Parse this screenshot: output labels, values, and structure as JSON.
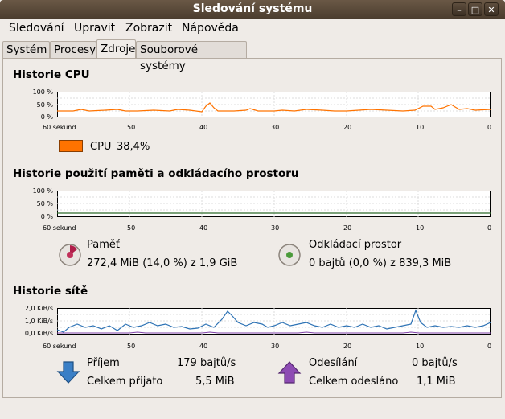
{
  "window": {
    "title": "Sledování systému"
  },
  "menu": [
    "Sledování",
    "Upravit",
    "Zobrazit",
    "Nápověda"
  ],
  "tabs": [
    {
      "label": "Systém",
      "active": false
    },
    {
      "label": "Procesy",
      "active": false
    },
    {
      "label": "Zdroje",
      "active": true
    },
    {
      "label": "Souborové systémy",
      "active": false
    }
  ],
  "cpu": {
    "title": "Historie CPU",
    "y_ticks": [
      "100 %",
      "50 %",
      "0 %"
    ],
    "x_ticks": [
      "60 sekund",
      "50",
      "40",
      "30",
      "20",
      "10",
      "0"
    ],
    "legend_label": "CPU",
    "legend_value": "38,4%",
    "color": "#ff7300"
  },
  "memory": {
    "title": "Historie použití paměti a odkládacího prostoru",
    "y_ticks": [
      "100 %",
      "50 %",
      "0 %"
    ],
    "x_ticks": [
      "60 sekund",
      "50",
      "40",
      "30",
      "20",
      "10",
      "0"
    ],
    "mem_label": "Paměť",
    "mem_value": "272,4 MiB (14,0 %) z 1,9 GiB",
    "swap_label": "Odkládací prostor",
    "swap_value": "0 bajtů (0,0 %) z 839,3 MiB"
  },
  "network": {
    "title": "Historie sítě",
    "y_ticks": [
      "2,0 KiB/s",
      "1,0 KiB/s",
      "0,0 KiB/s"
    ],
    "x_ticks": [
      "60 sekund",
      "50",
      "40",
      "30",
      "20",
      "10",
      "0"
    ],
    "recv_label": "Příjem",
    "recv_rate": "179 bajtů/s",
    "recv_total_label": "Celkem přijato",
    "recv_total": "5,5 MiB",
    "send_label": "Odesílání",
    "send_rate": "0 bajtů/s",
    "send_total_label": "Celkem odesláno",
    "send_total": "1,1 MiB",
    "recv_color": "#2e73b5",
    "send_color": "#7e3fa6"
  }
}
